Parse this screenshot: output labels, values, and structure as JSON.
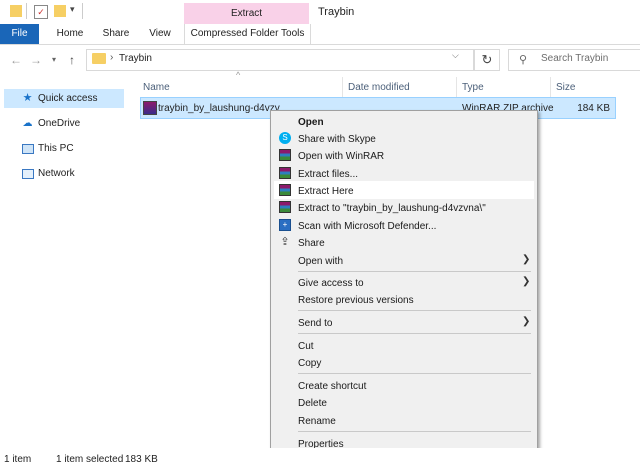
{
  "window": {
    "title": "Traybin",
    "context_tab_group": "Extract"
  },
  "ribbon": {
    "tabs": [
      "File",
      "Home",
      "Share",
      "View",
      "Compressed Folder Tools"
    ]
  },
  "address": {
    "path": "Traybin",
    "search_placeholder": "Search Traybin"
  },
  "columns": {
    "name": "Name",
    "date": "Date modified",
    "type": "Type",
    "size": "Size"
  },
  "sidebar": {
    "items": [
      {
        "label": "Quick access",
        "icon": "star-icon"
      },
      {
        "label": "OneDrive",
        "icon": "cloud-icon"
      },
      {
        "label": "This PC",
        "icon": "computer-icon"
      },
      {
        "label": "Network",
        "icon": "network-icon"
      }
    ]
  },
  "file": {
    "name": "traybin_by_laushung-d4vzv",
    "type": "WinRAR ZIP archive",
    "size": "184 KB"
  },
  "context_menu": {
    "items": [
      {
        "label": "Open",
        "bold": true
      },
      {
        "label": "Share with Skype",
        "icon": "skype-icon"
      },
      {
        "label": "Open with WinRAR",
        "icon": "winrar-icon"
      },
      {
        "label": "Extract files...",
        "icon": "winrar-icon"
      },
      {
        "label": "Extract Here",
        "icon": "winrar-icon"
      },
      {
        "label": "Extract to \"traybin_by_laushung-d4vzvna\\\"",
        "icon": "winrar-icon"
      },
      {
        "label": "Scan with Microsoft Defender...",
        "icon": "defender-icon"
      },
      {
        "label": "Share",
        "icon": "share-icon"
      },
      {
        "label": "Open with",
        "submenu": true
      },
      {
        "label": "Give access to",
        "submenu": true
      },
      {
        "label": "Restore previous versions"
      },
      {
        "label": "Send to",
        "submenu": true
      },
      {
        "label": "Cut"
      },
      {
        "label": "Copy"
      },
      {
        "label": "Create shortcut"
      },
      {
        "label": "Delete"
      },
      {
        "label": "Rename"
      },
      {
        "label": "Properties"
      }
    ],
    "highlighted": "Extract Here"
  },
  "status": {
    "count": "1 item",
    "selected": "1 item selected",
    "size": "183 KB"
  },
  "colors": {
    "file_tab": "#1a66b8",
    "extract_tab": "#f9d1e8",
    "selection": "#cce8ff",
    "menu_bg": "#f0f0f0"
  }
}
